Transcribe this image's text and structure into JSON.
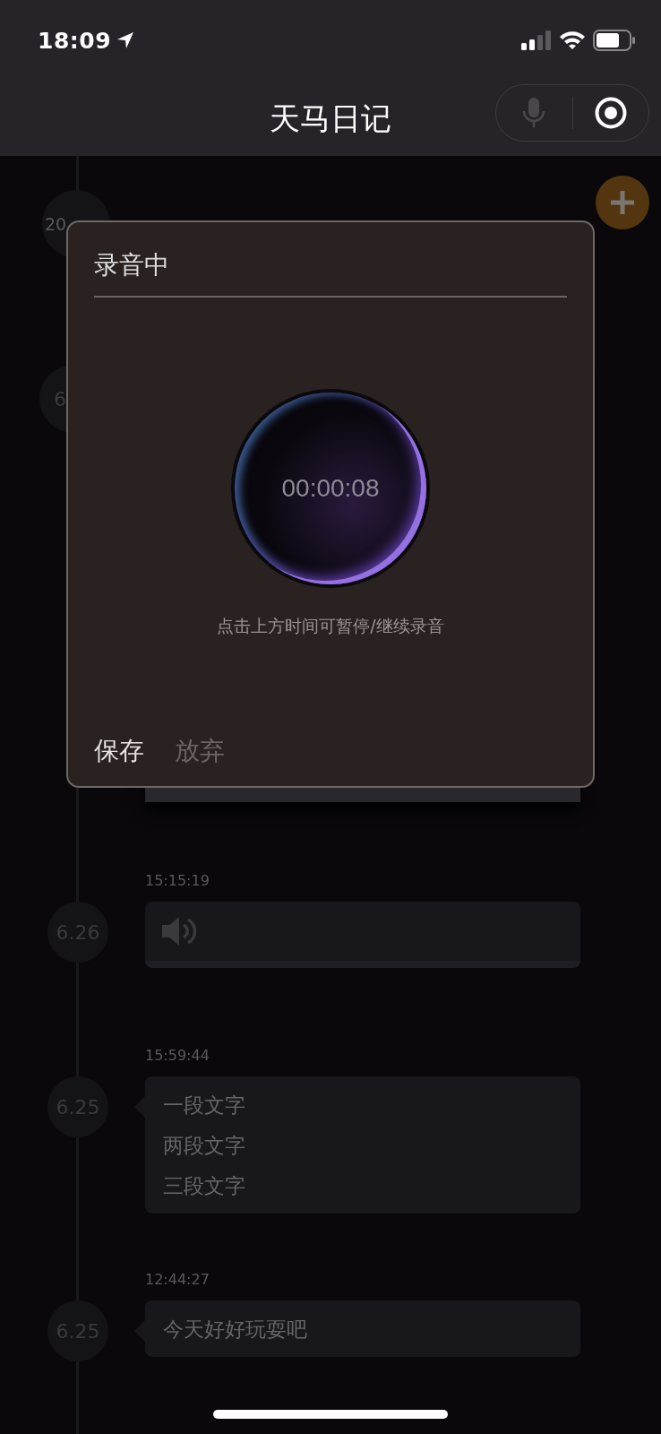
{
  "status_bar": {
    "time": "18:09"
  },
  "nav": {
    "title": "天马日记",
    "mic_enabled": false
  },
  "timeline": [
    {
      "kind": "year",
      "date": "20"
    },
    {
      "kind": "covered",
      "date": "6"
    },
    {
      "kind": "voice",
      "time": "15:15:19",
      "date": "6.26"
    },
    {
      "kind": "text",
      "time": "15:59:44",
      "date": "6.25",
      "lines": [
        "一段文字",
        "两段文字",
        "三段文字"
      ]
    },
    {
      "kind": "text",
      "time": "12:44:27",
      "date": "6.25",
      "lines": [
        "今天好好玩耍吧"
      ]
    }
  ],
  "dialog": {
    "title": "录音中",
    "timer": "00:00:08",
    "hint": "点击上方时间可暂停/继续录音",
    "buttons": [
      {
        "label": "保存",
        "primary": true
      },
      {
        "label": "放弃",
        "primary": false
      }
    ]
  }
}
